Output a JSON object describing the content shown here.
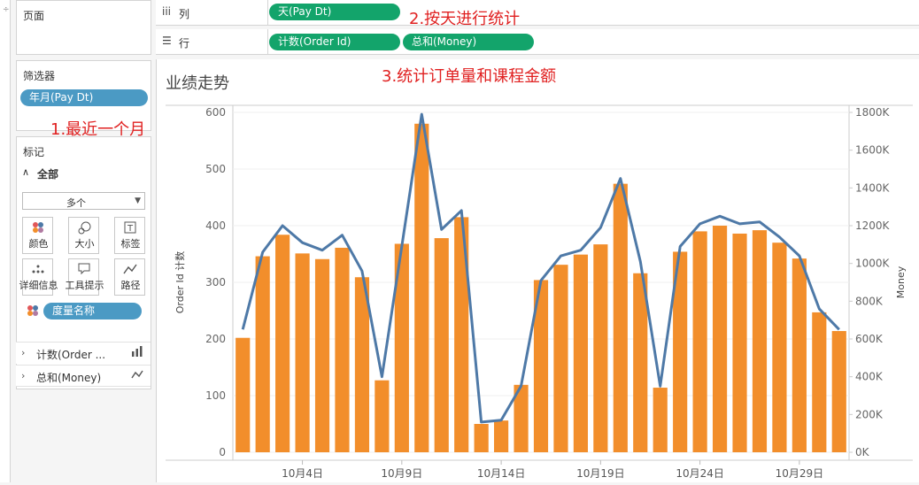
{
  "left_strip_glyph": "÷",
  "pages_panel": {
    "title": "页面"
  },
  "filters_panel": {
    "title": "筛选器",
    "pill": "年月(Pay Dt)"
  },
  "marks_panel": {
    "title": "标记",
    "all_label": "全部",
    "mark_type": "多个",
    "buttons": [
      {
        "label": "颜色",
        "icon": "color-icon"
      },
      {
        "label": "大小",
        "icon": "size-icon"
      },
      {
        "label": "标签",
        "icon": "label-icon"
      },
      {
        "label": "详细信息",
        "icon": "detail-icon"
      },
      {
        "label": "工具提示",
        "icon": "tooltip-icon"
      },
      {
        "label": "路径",
        "icon": "path-icon"
      }
    ],
    "measure_names_pill": "度量名称",
    "cards": [
      {
        "label": "计数(Order ...",
        "icon": "bar-icon"
      },
      {
        "label": "总和(Money)",
        "icon": "line-icon"
      }
    ]
  },
  "columns_shelf": {
    "icon": "iii",
    "label": "列",
    "pills": [
      "天(Pay Dt)"
    ]
  },
  "rows_shelf": {
    "icon": "☰",
    "label": "行",
    "pills": [
      "计数(Order Id)",
      "总和(Money)"
    ]
  },
  "annotations": {
    "a1": "1.最近一个月",
    "a2": "2.按天进行统计",
    "a3": "3.统计订单量和课程金额"
  },
  "colors": {
    "bar": "#f28e2b",
    "line": "#4e79a7",
    "green_pill": "#13a46b",
    "blue_pill": "#4b9ac4",
    "annotation": "#e02020"
  },
  "chart_data": {
    "type": "bar",
    "title": "业绩走势",
    "ylabel": "Order Id 计数",
    "y2label": "Money",
    "ylim": [
      0,
      600
    ],
    "y2lim": [
      0,
      1800000
    ],
    "yticks": [
      "0",
      "100",
      "200",
      "300",
      "400",
      "500",
      "600"
    ],
    "y2ticks": [
      "0K",
      "200K",
      "400K",
      "600K",
      "800K",
      "1000K",
      "1200K",
      "1400K",
      "1600K",
      "1800K"
    ],
    "xticks": [
      {
        "day": 4,
        "label": "10月4日"
      },
      {
        "day": 9,
        "label": "10月9日"
      },
      {
        "day": 14,
        "label": "10月14日"
      },
      {
        "day": 19,
        "label": "10月19日"
      },
      {
        "day": 24,
        "label": "10月24日"
      },
      {
        "day": 29,
        "label": "10月29日"
      }
    ],
    "days": [
      1,
      2,
      3,
      4,
      5,
      6,
      7,
      8,
      9,
      10,
      11,
      12,
      13,
      14,
      15,
      16,
      17,
      18,
      19,
      20,
      21,
      22,
      23,
      24,
      25,
      26,
      27,
      28,
      29,
      30,
      31
    ],
    "series": [
      {
        "name": "计数(Order Id)",
        "type": "bar",
        "axis": "left",
        "values": [
          202,
          346,
          384,
          351,
          341,
          361,
          309,
          127,
          368,
          580,
          378,
          415,
          50,
          56,
          119,
          304,
          331,
          349,
          367,
          474,
          316,
          114,
          354,
          390,
          400,
          386,
          392,
          370,
          342,
          247,
          214
        ]
      },
      {
        "name": "总和(Money)",
        "type": "line",
        "axis": "right",
        "values": [
          650000,
          1060000,
          1200000,
          1110000,
          1070000,
          1150000,
          960000,
          400000,
          1090000,
          1790000,
          1180000,
          1280000,
          160000,
          170000,
          350000,
          910000,
          1040000,
          1070000,
          1190000,
          1450000,
          1010000,
          350000,
          1090000,
          1210000,
          1250000,
          1210000,
          1220000,
          1140000,
          1040000,
          760000,
          650000
        ]
      }
    ]
  }
}
